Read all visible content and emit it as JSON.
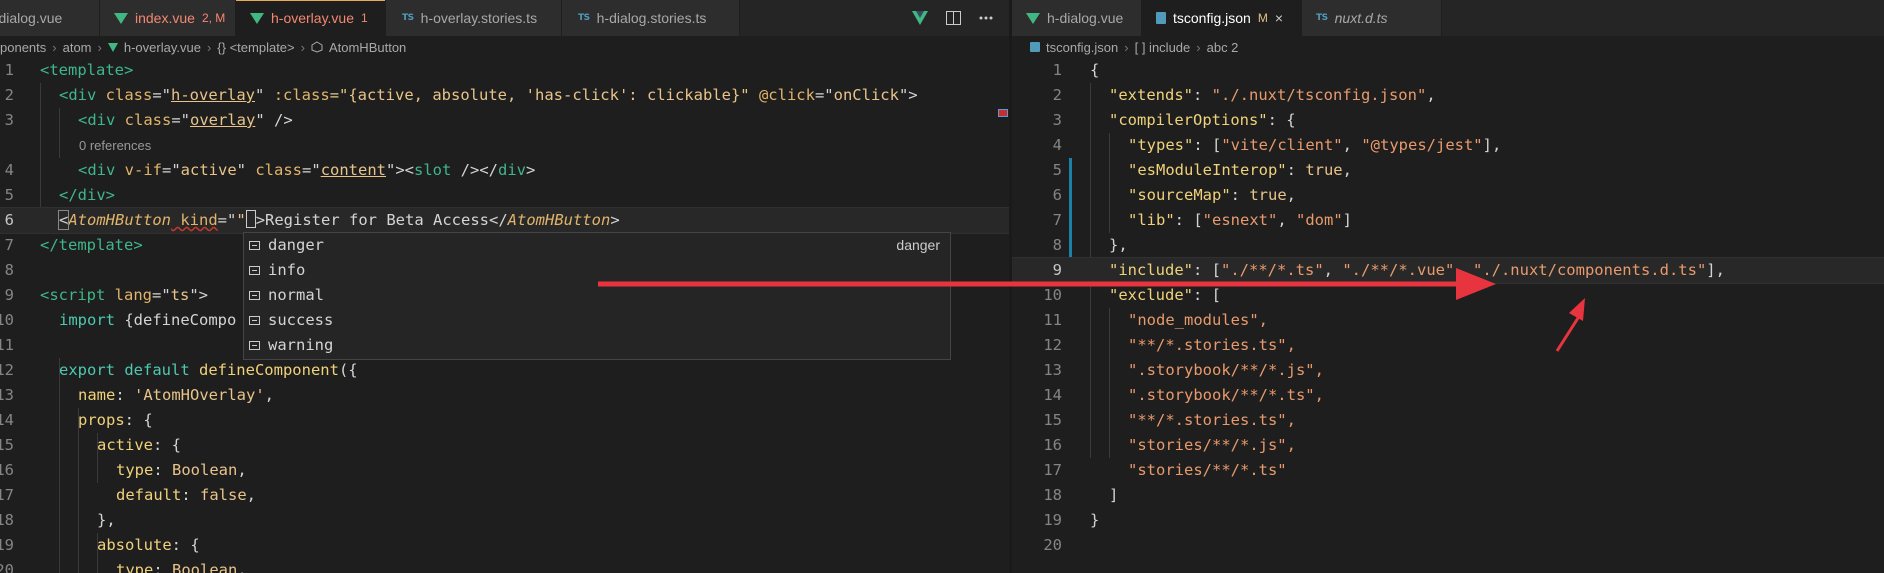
{
  "left_tabs": [
    {
      "name": "h-dialog.vue",
      "icon": "vue-icon",
      "state": "normal"
    },
    {
      "name": "index.vue",
      "icon": "vue-icon",
      "badge": "2, M",
      "state": "modified"
    },
    {
      "name": "h-overlay.vue",
      "icon": "vue-icon",
      "badge": "1",
      "state": "active-dirty"
    },
    {
      "name": "h-overlay.stories.ts",
      "icon": "ts-icon",
      "state": "normal"
    },
    {
      "name": "h-dialog.stories.ts",
      "icon": "ts-icon",
      "state": "normal"
    }
  ],
  "right_tabs": [
    {
      "name": "h-dialog.vue",
      "icon": "vue-icon",
      "state": "normal"
    },
    {
      "name": "tsconfig.json",
      "icon": "json-icon",
      "badge": "M",
      "state": "active"
    },
    {
      "name": "nuxt.d.ts",
      "icon": "ts-icon",
      "state": "preview"
    }
  ],
  "tab_icon_labels": {
    "ts": "TS",
    "close": "×"
  },
  "left_breadcrumb": [
    "ponents",
    "atom",
    "h-overlay.vue",
    "{} <template>",
    "AtomHButton"
  ],
  "right_breadcrumb": [
    "tsconfig.json",
    "[ ] include",
    "abc 2"
  ],
  "codelens": "0 references",
  "left_line_numbers": [
    "1",
    "2",
    "3",
    "4",
    "5",
    "6",
    "7",
    "8",
    "9",
    "10",
    "11",
    "12",
    "13",
    "14",
    "15",
    "16",
    "17",
    "18",
    "19",
    "20"
  ],
  "right_line_numbers": [
    "1",
    "2",
    "3",
    "4",
    "5",
    "6",
    "7",
    "8",
    "9",
    "10",
    "11",
    "12",
    "13",
    "14",
    "15",
    "16",
    "17",
    "18",
    "19",
    "20"
  ],
  "left_code": {
    "l1": "<template>",
    "l2a": "<div ",
    "l2b": "class",
    "l2c": "=\"",
    "l2d": "h-overlay",
    "l2e": "\" ",
    "l2f": ":class",
    "l2g": "=\"{active, absolute, 'has-click': clickable}\" ",
    "l2h": "@click",
    "l2i": "=\"",
    "l2j": "onClick",
    "l2k": "\">",
    "l3a": "<div ",
    "l3b": "class",
    "l3c": "=\"",
    "l3d": "overlay",
    "l3e": "\" />",
    "l4a": "<div ",
    "l4b": "v-if",
    "l4c": "=\"",
    "l4d": "active",
    "l4e": "\" ",
    "l4f": "class",
    "l4g": "=\"",
    "l4h": "content",
    "l4i": "\"><",
    "l4j": "slot",
    "l4k": " /></",
    "l4l": "div",
    "l4m": ">",
    "l5": "</div>",
    "l6a": "<",
    "l6b": "AtomHButton",
    "l6c": " kind",
    "l6d": "=\"",
    "l6e": "\"",
    "l6f": ">Register for Beta Access</",
    "l6g": "AtomHButton",
    "l6h": ">",
    "l7": "</template>",
    "l9a": "<script ",
    "l9b": "lang",
    "l9c": "=\"",
    "l9d": "ts",
    "l9e": "\">",
    "l10a": "import ",
    "l10b": "{defineCompo",
    "l12a": "export default ",
    "l12b": "defineComponent",
    "l12c": "({",
    "l13a": "name",
    "l13b": ": ",
    "l13c": "'AtomHOverlay'",
    "l13d": ",",
    "l14a": "props",
    "l14b": ": {",
    "l15a": "active",
    "l15b": ": {",
    "l16a": "type",
    "l16b": ": ",
    "l16c": "Boolean",
    "l16d": ",",
    "l17a": "default",
    "l17b": ": ",
    "l17c": "false",
    "l17d": ",",
    "l18": "},",
    "l19a": "absolute",
    "l19b": ": {",
    "l20a": "type",
    "l20b": ": ",
    "l20c": "Boolean",
    "l20d": ","
  },
  "suggestions": [
    {
      "label": "danger",
      "detail": "danger"
    },
    {
      "label": "info",
      "detail": ""
    },
    {
      "label": "normal",
      "detail": ""
    },
    {
      "label": "success",
      "detail": ""
    },
    {
      "label": "warning",
      "detail": ""
    }
  ],
  "right_code": {
    "r1": "{",
    "r2a": "\"extends\"",
    "r2b": ": ",
    "r2c": "\"./.nuxt/tsconfig.json\"",
    "r2d": ",",
    "r3a": "\"compilerOptions\"",
    "r3b": ": {",
    "r4a": "\"types\"",
    "r4b": ": [",
    "r4c": "\"vite/client\"",
    "r4d": ", ",
    "r4e": "\"@types/jest\"",
    "r4f": "],",
    "r5a": "\"esModuleInterop\"",
    "r5b": ": ",
    "r5c": "true",
    "r5d": ",",
    "r6a": "\"sourceMap\"",
    "r6b": ": ",
    "r6c": "true",
    "r6d": ",",
    "r7a": "\"lib\"",
    "r7b": ": [",
    "r7c": "\"esnext\"",
    "r7d": ", ",
    "r7e": "\"dom\"",
    "r7f": "]",
    "r8": "},",
    "r9a": "\"include\"",
    "r9b": ": [",
    "r9c": "\"./**/*.ts\"",
    "r9d": ", ",
    "r9e": "\"./**/*.vue\"",
    "r9f": ", ",
    "r9g": "\"./.nuxt/components.d.ts\"",
    "r9h": "],",
    "r10a": "\"exclude\"",
    "r10b": ": [",
    "r11": "\"node_modules\",",
    "r12": "\"**/*.stories.ts\",",
    "r13": "\".storybook/**/*.js\",",
    "r14": "\".storybook/**/*.ts\",",
    "r15": "\"**/*.stories.ts\",",
    "r16": "\"stories/**/*.js\",",
    "r17": "\"stories/**/*.ts\"",
    "r18": "]",
    "r19": "}"
  },
  "colors": {
    "annotation_arrow": "#e8343f",
    "editor_bg": "#1e1e1e",
    "tab_bg": "#2d2d2d"
  }
}
